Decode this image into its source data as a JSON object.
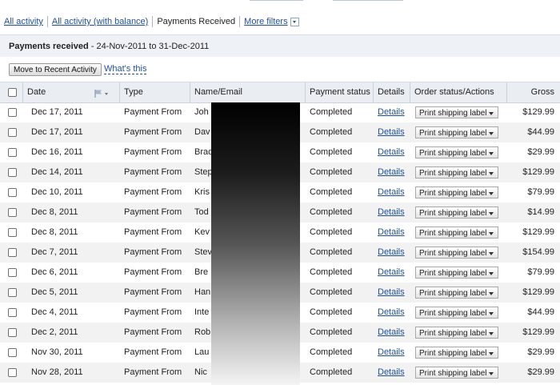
{
  "nav": {
    "all_activity": "All activity",
    "all_activity_balance": "All activity (with balance)",
    "payments_received": "Payments Received",
    "more_filters": "More filters"
  },
  "panel": {
    "title_bold": "Payments received",
    "title_range": " - 24-Nov-2011 to 31-Dec-2011"
  },
  "actions": {
    "move_button": "Move to Recent Activity",
    "whats_this": "What's this"
  },
  "table": {
    "columns": {
      "date": "Date",
      "type": "Type",
      "name_email": "Name/Email",
      "payment_status": "Payment status",
      "details": "Details",
      "order_status": "Order status/Actions",
      "gross": "Gross"
    },
    "rows": [
      {
        "date": "Dec 17, 2011",
        "type": "Payment From",
        "name": "Joh",
        "status": "Completed",
        "details": "Details",
        "action": "Print shipping label",
        "gross": "$129.99"
      },
      {
        "date": "Dec 17, 2011",
        "type": "Payment From",
        "name": "Dav",
        "status": "Completed",
        "details": "Details",
        "action": "Print shipping label",
        "gross": "$44.99"
      },
      {
        "date": "Dec 16, 2011",
        "type": "Payment From",
        "name": "Brad",
        "status": "Completed",
        "details": "Details",
        "action": "Print shipping label",
        "gross": "$29.99"
      },
      {
        "date": "Dec 14, 2011",
        "type": "Payment From",
        "name": "Step",
        "status": "Completed",
        "details": "Details",
        "action": "Print shipping label",
        "gross": "$129.99"
      },
      {
        "date": "Dec 10, 2011",
        "type": "Payment From",
        "name": "Kris",
        "status": "Completed",
        "details": "Details",
        "action": "Print shipping label",
        "gross": "$79.99"
      },
      {
        "date": "Dec 8, 2011",
        "type": "Payment From",
        "name": "Tod",
        "status": "Completed",
        "details": "Details",
        "action": "Print shipping label",
        "gross": "$14.99"
      },
      {
        "date": "Dec 8, 2011",
        "type": "Payment From",
        "name": "Kev",
        "status": "Completed",
        "details": "Details",
        "action": "Print shipping label",
        "gross": "$129.99"
      },
      {
        "date": "Dec 7, 2011",
        "type": "Payment From",
        "name": "Stev",
        "status": "Completed",
        "details": "Details",
        "action": "Print shipping label",
        "gross": "$154.99"
      },
      {
        "date": "Dec 6, 2011",
        "type": "Payment From",
        "name": "Bre",
        "status": "Completed",
        "details": "Details",
        "action": "Print shipping label",
        "gross": "$79.99"
      },
      {
        "date": "Dec 5, 2011",
        "type": "Payment From",
        "name": "Han",
        "status": "Completed",
        "details": "Details",
        "action": "Print shipping label",
        "gross": "$129.99"
      },
      {
        "date": "Dec 4, 2011",
        "type": "Payment From",
        "name": "Inte",
        "status": "Completed",
        "details": "Details",
        "action": "Print shipping label",
        "gross": "$44.99"
      },
      {
        "date": "Dec 2, 2011",
        "type": "Payment From",
        "name": "Rob",
        "status": "Completed",
        "details": "Details",
        "action": "Print shipping label",
        "gross": "$129.99"
      },
      {
        "date": "Nov 30, 2011",
        "type": "Payment From",
        "name": "Lau",
        "status": "Completed",
        "details": "Details",
        "action": "Print shipping label",
        "gross": "$29.99"
      },
      {
        "date": "Nov 28, 2011",
        "type": "Payment From",
        "name": "Nic",
        "status": "Completed",
        "details": "Details",
        "action": "Print shipping label",
        "gross": "$29.99"
      }
    ]
  },
  "colors": {
    "link": "#1f4f9a",
    "header_bg": "#eaeef3",
    "alt_row_bg": "#f2f2f2"
  }
}
